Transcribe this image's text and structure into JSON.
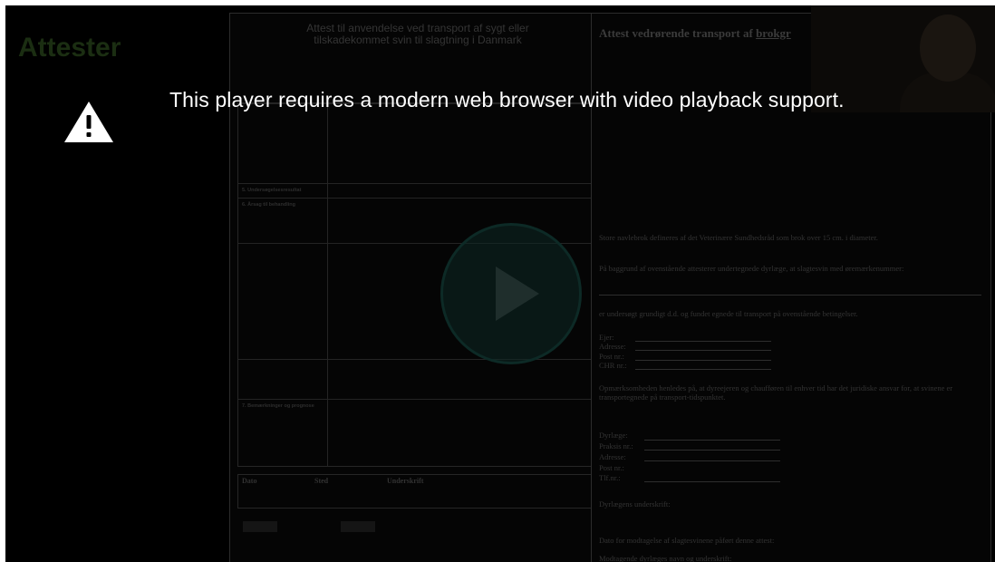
{
  "player": {
    "error_message": "This player requires a modern web browser with video playback support.",
    "icon": "warning-icon"
  },
  "slide": {
    "title": "Attester",
    "left_doc": {
      "title_line1": "Attest til anvendelse ved transport af sygt eller",
      "title_line2": "tilskadekommet svin til slagtning i Danmark",
      "section_5": "5. Undersøgelsesresultat",
      "section_6": "6. Årsag til behandling",
      "section_7": "7. Bemærkninger og prognose",
      "sig_date": "Dato",
      "sig_place": "Sted",
      "sig_signature": "Underskrift"
    },
    "right_doc": {
      "title_plain": "Attest vedrørende transport af ",
      "title_underlined": "brokgr",
      "p_definition": "Store navlebrok defineres af det Veterinære Sundhedsråd som brok over 15 cm. i diameter.",
      "p_basis": "På baggrund af ovenstående attesterer undertegnede dyrlæge, at slagtesvin med øremærkenummer:",
      "p_examined": "er undersøgt grundigt d.d. og fundet egnede til transport på ovenstående betingelser.",
      "f_owner": "Ejer:",
      "f_address": "Adresse:",
      "f_postno": "Post nr.:",
      "f_chr": "CHR nr.:",
      "p_attention": "Opmærksomheden henledes på, at dyreejeren og chaufføren til enhver tid har det juridiske ansvar for, at svinene er transportegnede på transport-tidspunktet.",
      "f_vet": "Dyrlæge:",
      "f_practice": "Praksis nr.:",
      "f_address2": "Adresse:",
      "f_postno2": "Post nr.:",
      "f_phone": "Tlf.nr.:",
      "f_vet_sig": "Dyrlægens underskrift:",
      "f_date_received": "Dato for modtagelse af slagtesvinene påført denne attest:",
      "f_receiver": "Modtagende dyrlæges navn og underskrift:"
    }
  },
  "colors": {
    "background": "#000000",
    "message_text": "#ffffff",
    "play_button": "#0d2a26"
  }
}
